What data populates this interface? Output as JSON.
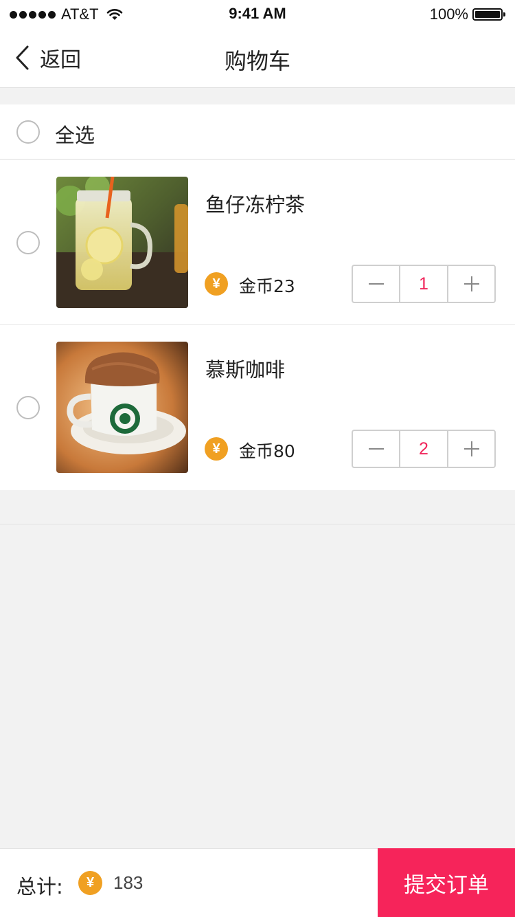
{
  "status_bar": {
    "carrier": "AT&T",
    "time": "9:41 AM",
    "battery": "100%"
  },
  "nav": {
    "back_label": "返回",
    "title": "购物车"
  },
  "select_all": {
    "label": "全选"
  },
  "items": [
    {
      "name": "鱼仔冻柠茶",
      "price": "金币23",
      "quantity": "1",
      "image": "iced-lemon-tea-photo"
    },
    {
      "name": "慕斯咖啡",
      "price": "金币80",
      "quantity": "2",
      "image": "mousse-coffee-photo"
    }
  ],
  "coin_symbol": "¥",
  "footer": {
    "total_label": "总计:",
    "total_value": "183",
    "submit_label": "提交订单"
  },
  "colors": {
    "accent": "#f6245a",
    "coin": "#f0a022",
    "background": "#f2f2f2"
  }
}
